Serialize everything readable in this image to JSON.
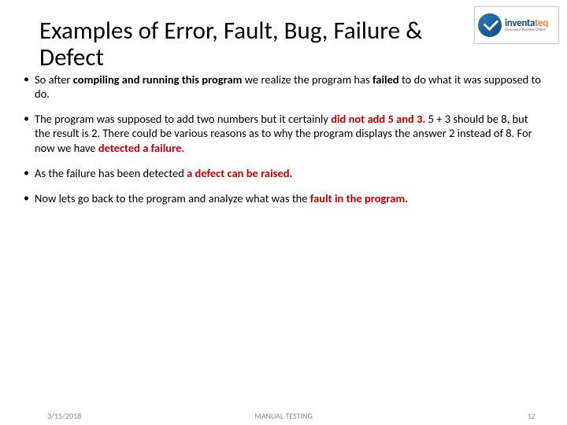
{
  "title": "Examples of Error, Fault, Bug, Failure & Defect",
  "logo": {
    "brand_pre": "inventa",
    "brand_accent": "teq",
    "tagline": "Grow your Business Online"
  },
  "bullets": {
    "b1": {
      "t1": "So after ",
      "r1": "compiling and running this program ",
      "t2": "we realize the program has ",
      "r2": "failed ",
      "t3": "to do what it was supposed to do."
    },
    "b2": {
      "t1": "The program was supposed to add two numbers but it certainly ",
      "r1": "did not add 5 and 3. ",
      "t2": "5 + 3 should be 8, but the result is 2. There could be various reasons as to why the program displays the answer 2 instead of 8. For now we have ",
      "r2": "detected a failure."
    },
    "b3": {
      "t1": "As the failure has been detected ",
      "r1": "a defect can be raised."
    },
    "b4": {
      "t1": "Now lets go back to the program and analyze what was the ",
      "r1": "fault in the program."
    }
  },
  "footer": {
    "date": "3/15/2018",
    "center": "MANUAL TESTING",
    "page": "12"
  }
}
